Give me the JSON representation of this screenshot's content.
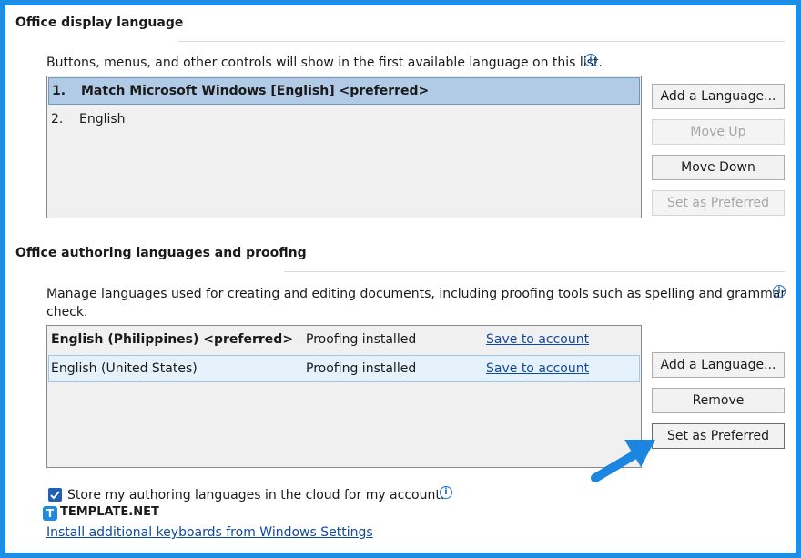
{
  "display_language": {
    "title": "Office display language",
    "description": "Buttons, menus, and other controls will show in the first available language on this list.",
    "info_glyph": "i",
    "languages": [
      {
        "num": "1.",
        "name": "Match Microsoft Windows [English] <preferred>",
        "selected": true
      },
      {
        "num": "2.",
        "name": "English",
        "selected": false
      }
    ],
    "buttons": {
      "add_language": "Add a Language...",
      "move_up": "Move Up",
      "move_down": "Move Down",
      "set_preferred": "Set as Preferred"
    }
  },
  "authoring": {
    "title": "Office authoring languages and proofing",
    "description_line1": "Manage languages used for creating and editing documents, including proofing tools such as spelling and grammar",
    "description_line2": "check.",
    "info_glyph": "i",
    "languages": [
      {
        "name": "English (Philippines) <preferred>",
        "status": "Proofing installed",
        "action": "Save to account"
      },
      {
        "name": "English (United States)",
        "status": "Proofing installed",
        "action": "Save to account"
      }
    ],
    "buttons": {
      "add_language": "Add a Language...",
      "remove": "Remove",
      "set_preferred": "Set as Preferred"
    }
  },
  "cloud_option": {
    "label": "Store my authoring languages in the cloud for my account.",
    "checked": true,
    "info_glyph": "i"
  },
  "watermark": {
    "glyph": "T",
    "text": "TEMPLATE.NET"
  },
  "install_link": "Install additional keyboards from Windows Settings",
  "colors": {
    "frame": "#1c8ee6",
    "selection": "#b1cbe6",
    "link": "#0e4a9e",
    "arrow": "#1a86e0"
  }
}
